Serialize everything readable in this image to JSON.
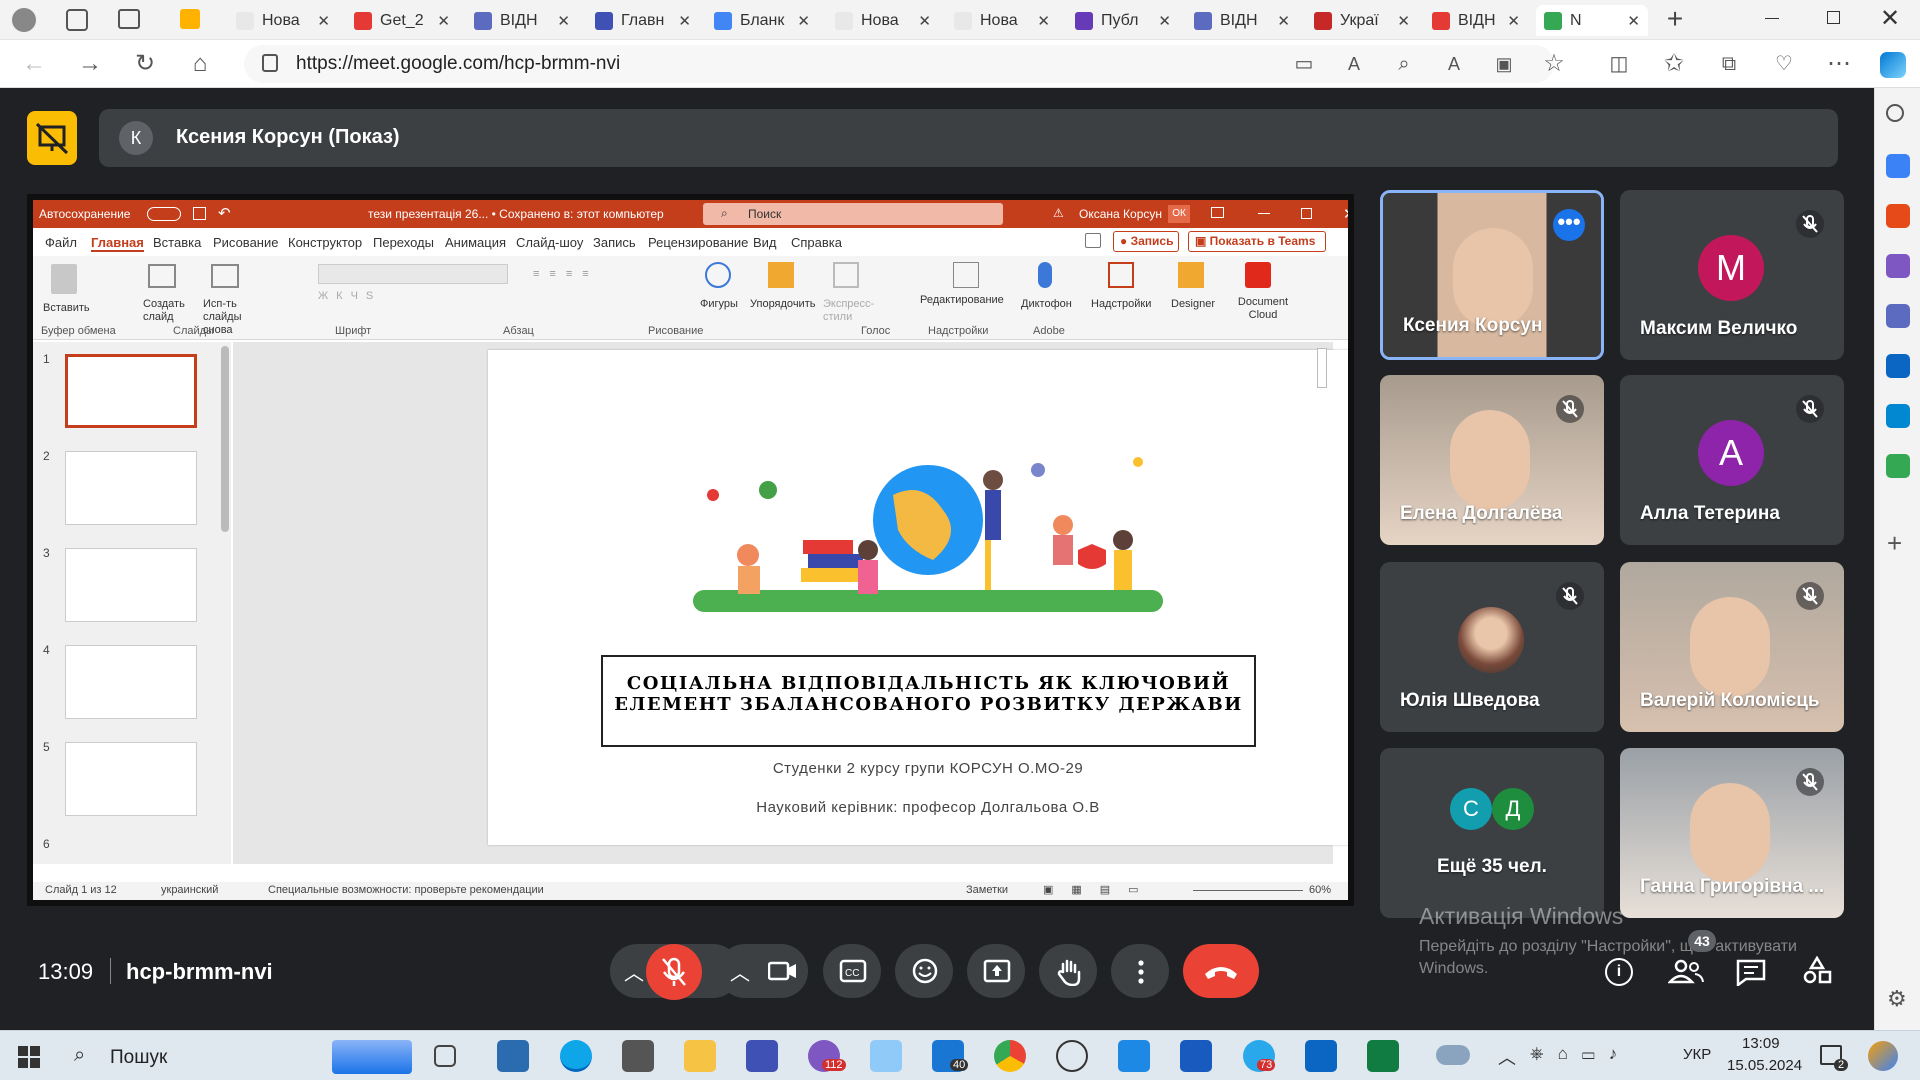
{
  "browser": {
    "tabs": [
      {
        "label": "Нова",
        "color": "#e8e8e8"
      },
      {
        "label": "Get_2",
        "color": "#e53935"
      },
      {
        "label": "ВІДН",
        "color": "#5c6bc0"
      },
      {
        "label": "Главн",
        "color": "#3f51b5"
      },
      {
        "label": "Бланк",
        "color": "#4285f4"
      },
      {
        "label": "Нова",
        "color": "#e8e8e8"
      },
      {
        "label": "Нова",
        "color": "#e8e8e8"
      },
      {
        "label": "Публ",
        "color": "#673ab7"
      },
      {
        "label": "ВІДН",
        "color": "#5c6bc0"
      },
      {
        "label": "Украї",
        "color": "#c62828"
      },
      {
        "label": "ВІДН",
        "color": "#e53935"
      },
      {
        "label": "N",
        "color": "#34a853"
      }
    ],
    "url": "https://meet.google.com/hcp-brmm-nvi"
  },
  "meet": {
    "presenter_initial": "К",
    "presenter_title": "Ксения Корсун (Показ)",
    "time": "13:09",
    "meeting_code": "hcp-brmm-nvi",
    "participants_count": "43",
    "participants": [
      {
        "name": "Ксения Корсун",
        "type": "video",
        "muted": false
      },
      {
        "name": "Максим Величко",
        "type": "avatar",
        "initial": "M",
        "color": "#c2185b",
        "muted": true
      },
      {
        "name": "Елена Долгалёва",
        "type": "video",
        "muted": true
      },
      {
        "name": "Алла Тетерина",
        "type": "avatar",
        "initial": "A",
        "color": "#8e24aa",
        "muted": true
      },
      {
        "name": "Юлія Шведова",
        "type": "photo",
        "muted": true
      },
      {
        "name": "Валерій Коломієць",
        "type": "video",
        "muted": true
      },
      {
        "name": "Ещё 35 чел.",
        "type": "more",
        "initials": [
          "С",
          "Д"
        ],
        "colors": [
          "#129eaf",
          "#1e8e3e"
        ]
      },
      {
        "name": "Ганна Григорівна ...",
        "type": "video",
        "muted": true
      }
    ],
    "watermark": {
      "title": "Активація Windows",
      "line1": "Перейдіть до розділу \"Настройки\", щоб активувати",
      "line2": "Windows."
    }
  },
  "ppt": {
    "autosave": "Автосохранение",
    "doc_title": "тези презентація 26... • Сохранено в: этот компьютер",
    "search": "Поиск",
    "user": "Оксана Корсун",
    "user_initials": "ОК",
    "menu": [
      "Файл",
      "Главная",
      "Вставка",
      "Рисование",
      "Конструктор",
      "Переходы",
      "Анимация",
      "Слайд-шоу",
      "Запись",
      "Рецензирование",
      "Вид",
      "Справка"
    ],
    "record_btn": "Запись",
    "teams_btn": "Показать в Teams",
    "ribbon_groups": [
      "Буфер обмена",
      "Слайды",
      "Шрифт",
      "Абзац",
      "Рисование",
      "Голос",
      "Надстройки",
      "Adobe"
    ],
    "ribbon_buttons": {
      "paste": "Вставить",
      "new_slide": "Создать слайд",
      "reuse": "Исп-ть слайды снова",
      "shapes": "Фигуры",
      "arrange": "Упорядочить",
      "styles": "Экспресс-стили",
      "editing": "Редактирование",
      "dictate": "Диктофон",
      "addins": "Надстройки",
      "designer": "Designer",
      "doc_cloud": "Document Cloud"
    },
    "slide_numbers": [
      "1",
      "2",
      "3",
      "4",
      "5",
      "6"
    ],
    "slide": {
      "title_line1": "СОЦІАЛЬНА ВІДПОВІДАЛЬНІСТЬ ЯК КЛЮЧОВИЙ",
      "title_line2": "ЕЛЕМЕНТ ЗБАЛАНСОВАНОГО РОЗВИТКУ ДЕРЖАВИ",
      "subtitle": "Студенки 2 курсу групи КОРСУН О.МО-29",
      "supervisor": "Науковий керівник: професор Долгальова О.В"
    },
    "status": {
      "slide_of": "Слайд 1 из 12",
      "lang": "украинский",
      "access": "Специальные возможности: проверьте рекомендации",
      "notes": "Заметки",
      "zoom": "60%"
    }
  },
  "taskbar": {
    "search": "Пошук",
    "lang": "УКР",
    "time": "13:09",
    "date": "15.05.2024",
    "badges": {
      "viber": "112",
      "mail": "40",
      "telegram": "73",
      "notif": "2"
    }
  }
}
